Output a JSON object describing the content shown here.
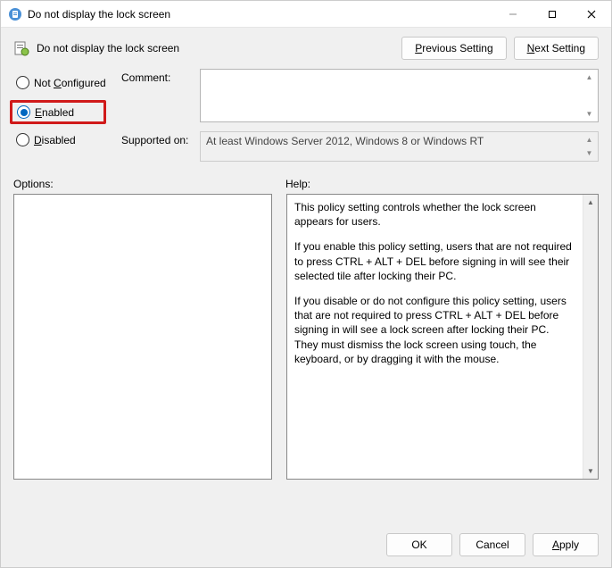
{
  "titlebar": {
    "title": "Do not display the lock screen"
  },
  "header": {
    "policy_title": "Do not display the lock screen",
    "previous": "Previous Setting",
    "next": "Next Setting",
    "next_u": "N"
  },
  "radios": {
    "not_configured": "Not Configured",
    "not_configured_u": "C",
    "enabled": "Enabled",
    "enabled_u": "E",
    "disabled": "Disabled",
    "disabled_u": "D"
  },
  "fields": {
    "comment_label": "Comment:",
    "supported_label": "Supported on:",
    "supported_value": "At least Windows Server 2012, Windows 8 or Windows RT"
  },
  "lower": {
    "options_label": "Options:",
    "help_label": "Help:"
  },
  "help": {
    "p1": "This policy setting controls whether the lock screen appears for users.",
    "p2": "If you enable this policy setting, users that are not required to press CTRL + ALT + DEL before signing in will see their selected tile after locking their PC.",
    "p3": "If you disable or do not configure this policy setting, users that are not required to press CTRL + ALT + DEL before signing in will see a lock screen after locking their PC. They must dismiss the lock screen using touch, the keyboard, or by dragging it with the mouse."
  },
  "footer": {
    "ok": "OK",
    "cancel": "Cancel",
    "apply": "Apply",
    "apply_u": "A"
  }
}
